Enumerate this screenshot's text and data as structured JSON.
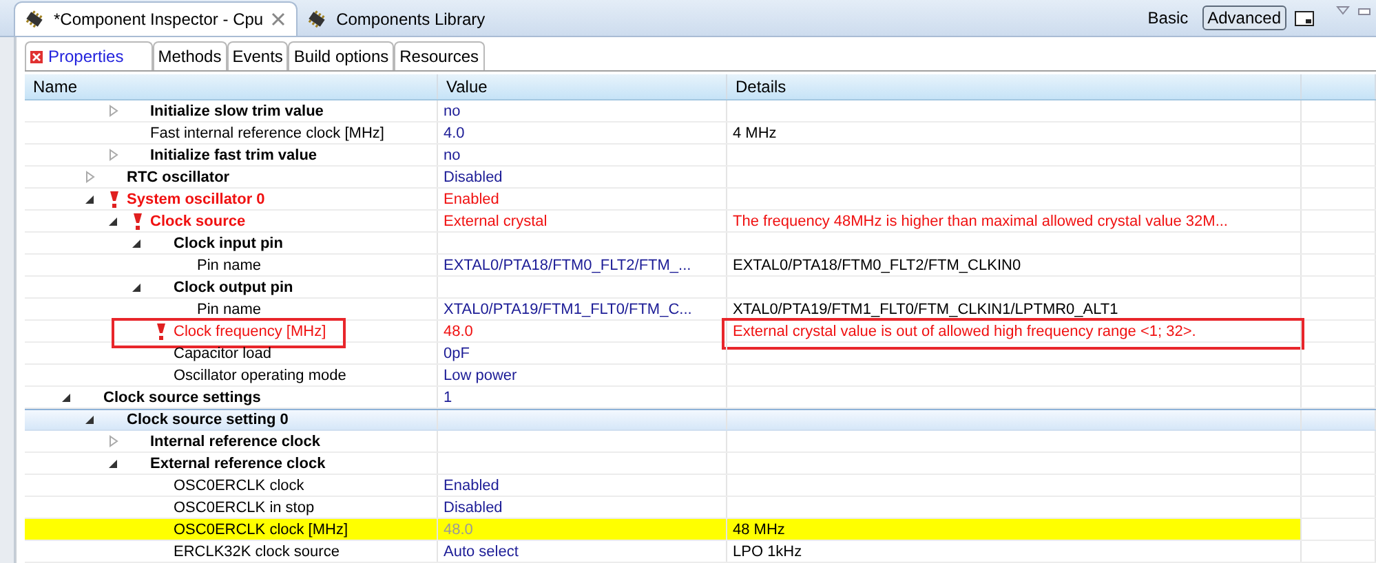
{
  "editor_tabs": [
    {
      "label": "*Component Inspector - Cpu",
      "selected": true,
      "closable": true
    },
    {
      "label": "Components Library",
      "selected": false,
      "closable": false
    }
  ],
  "view_modes": [
    {
      "label": "Basic",
      "selected": false
    },
    {
      "label": "Advanced",
      "selected": true
    }
  ],
  "subtabs": [
    {
      "label": "Properties",
      "selected": true,
      "error": true
    },
    {
      "label": "Methods",
      "selected": false,
      "error": false
    },
    {
      "label": "Events",
      "selected": false,
      "error": false
    },
    {
      "label": "Build options",
      "selected": false,
      "error": false
    },
    {
      "label": "Resources",
      "selected": false,
      "error": false
    }
  ],
  "table": {
    "columns": [
      "Name",
      "Value",
      "Details"
    ],
    "rows": [
      {
        "children": [
          {
            "children": [
              {
                "name": "Initialize slow trim value",
                "kind": "group",
                "expanded": false,
                "selected": false,
                "error": false,
                "value": "no"
              },
              {
                "name": "Fast internal reference clock [MHz]",
                "kind": "property",
                "selected": false,
                "error": false,
                "value": "4.0",
                "details": "4 MHz"
              },
              {
                "name": "Initialize fast trim value",
                "kind": "group",
                "expanded": false,
                "selected": false,
                "error": false,
                "value": "no"
              }
            ]
          },
          {
            "name": "RTC oscillator",
            "kind": "group",
            "expanded": false,
            "selected": false,
            "error": false,
            "value": "Disabled"
          },
          {
            "name": "System oscillator 0",
            "kind": "group",
            "expanded": true,
            "selected": false,
            "error": true,
            "value": "Enabled",
            "children": [
              {
                "name": "Clock source",
                "kind": "group",
                "expanded": true,
                "selected": false,
                "error": true,
                "value": "External crystal",
                "details": "The frequency 48MHz is higher than maximal allowed crystal value 32M...",
                "children": [
                  {
                    "name": "Clock input pin",
                    "kind": "group",
                    "expanded": true,
                    "selected": false,
                    "error": false,
                    "children": [
                      {
                        "name": "Pin name",
                        "kind": "property",
                        "selected": false,
                        "error": false,
                        "value": "EXTAL0/PTA18/FTM0_FLT2/FTM_...",
                        "details": "EXTAL0/PTA18/FTM0_FLT2/FTM_CLKIN0"
                      }
                    ]
                  },
                  {
                    "name": "Clock output pin",
                    "kind": "group",
                    "expanded": true,
                    "selected": false,
                    "error": false,
                    "children": [
                      {
                        "name": "Pin name",
                        "kind": "property",
                        "selected": false,
                        "error": false,
                        "value": "XTAL0/PTA19/FTM1_FLT0/FTM_C...",
                        "details": "XTAL0/PTA19/FTM1_FLT0/FTM_CLKIN1/LPTMR0_ALT1"
                      }
                    ]
                  },
                  {
                    "name": "Clock frequency [MHz]",
                    "kind": "property",
                    "selected": false,
                    "error": true,
                    "annotated": true,
                    "value": "48.0",
                    "details": "External crystal value is out of allowed high frequency range <1; 32>."
                  },
                  {
                    "name": "Capacitor load",
                    "kind": "property",
                    "selected": false,
                    "error": false,
                    "value": "0pF"
                  },
                  {
                    "name": "Oscillator operating mode",
                    "kind": "property",
                    "selected": false,
                    "error": false,
                    "value": "Low power"
                  }
                ]
              }
            ]
          }
        ]
      },
      {
        "name": "Clock source settings",
        "kind": "group",
        "expanded": true,
        "selected": false,
        "error": false,
        "value": "1",
        "children": [
          {
            "name": "Clock source setting 0",
            "kind": "group",
            "expanded": true,
            "selected": true,
            "error": false,
            "children": [
              {
                "name": "Internal reference clock",
                "kind": "group",
                "expanded": false,
                "selected": false,
                "error": false
              },
              {
                "name": "External reference clock",
                "kind": "group",
                "expanded": true,
                "selected": false,
                "error": false,
                "children": [
                  {
                    "name": "OSC0ERCLK clock",
                    "kind": "property",
                    "selected": false,
                    "error": false,
                    "value": "Enabled"
                  },
                  {
                    "name": "OSC0ERCLK in stop",
                    "kind": "property",
                    "selected": false,
                    "error": false,
                    "value": "Disabled"
                  },
                  {
                    "name": "OSC0ERCLK clock [MHz]",
                    "kind": "property",
                    "selected": false,
                    "error": false,
                    "highlighted": true,
                    "read_only": true,
                    "value": "48.0",
                    "details": "48 MHz"
                  },
                  {
                    "name": "ERCLK32K clock source",
                    "kind": "property",
                    "selected": false,
                    "error": false,
                    "value": "Auto select",
                    "details": "LPO 1kHz"
                  }
                ]
              }
            ]
          }
        ]
      }
    ]
  }
}
